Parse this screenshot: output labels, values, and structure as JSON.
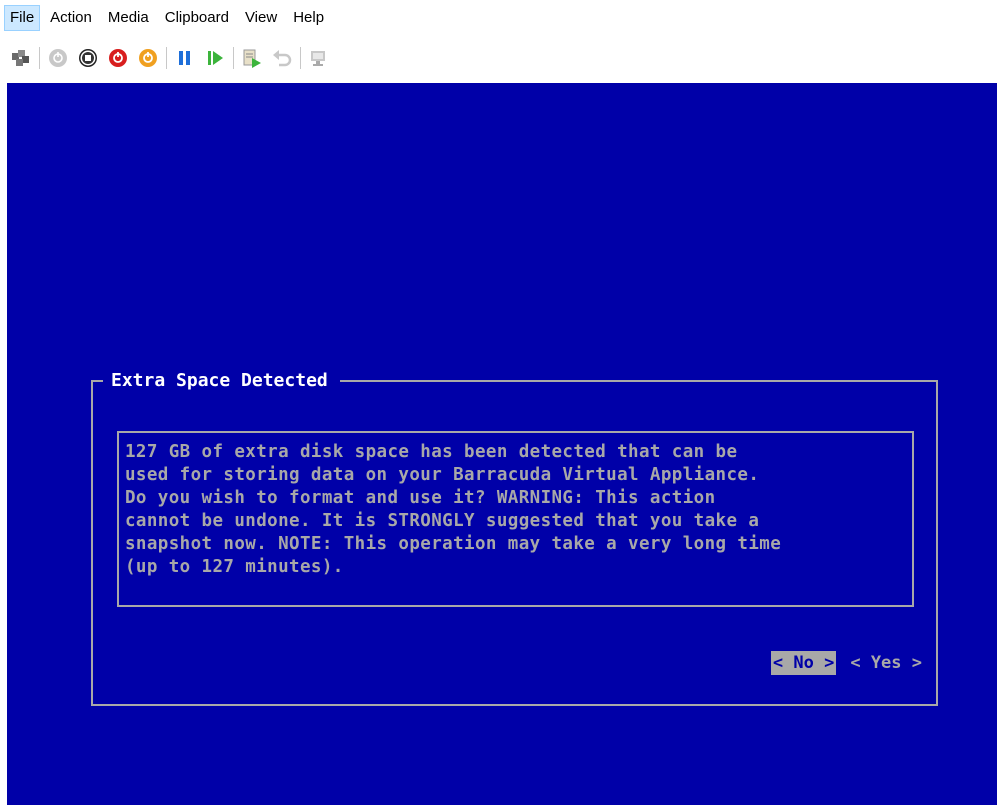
{
  "menu": {
    "items": [
      "File",
      "Action",
      "Media",
      "Clipboard",
      "View",
      "Help"
    ]
  },
  "toolbar": {
    "icons": [
      "ctrl-alt-del-icon",
      "start-icon",
      "turn-off-icon",
      "shut-down-icon",
      "save-icon",
      "pause-icon",
      "reset-icon",
      "checkpoint-icon",
      "revert-icon",
      "enhanced-session-icon"
    ]
  },
  "dialog": {
    "title": "Extra Space Detected",
    "message_lines": [
      "127 GB of extra disk space has been detected that can be",
      "used for storing data on your Barracuda Virtual Appliance.",
      "Do you wish to format and use it? WARNING: This action",
      "cannot be undone. It is STRONGLY suggested that you take a",
      "snapshot now. NOTE: This operation may take a very long time",
      "(up to 127 minutes)."
    ],
    "no_label": "< No >",
    "yes_label": "< Yes >"
  },
  "colors": {
    "console_bg": "#0000a8",
    "text_gray": "#a8a8a8",
    "title_white": "#ffffff"
  }
}
